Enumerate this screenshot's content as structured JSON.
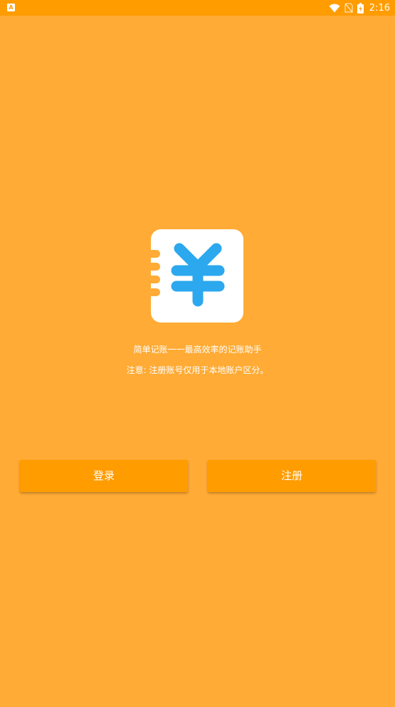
{
  "status_bar": {
    "time": "2:16",
    "notification_glyph": "A",
    "icons": [
      "wifi-icon",
      "sim-off-icon",
      "battery-icon"
    ]
  },
  "app": {
    "icon": "yuan-notebook-icon",
    "icon_colors": {
      "background": "#FFFFFF",
      "symbol": "#2BA8EE",
      "rings": "#FFAB35"
    },
    "tagline": "简单记账一一最高效率的记账助手",
    "note": "注意: 注册账号仅用于本地账户区分。"
  },
  "buttons": {
    "login_label": "登录",
    "register_label": "注册"
  },
  "colors": {
    "background": "#FFAB35",
    "status_bar": "#FF9C00",
    "button": "#FF9C00",
    "text": "#FFFFFF"
  }
}
